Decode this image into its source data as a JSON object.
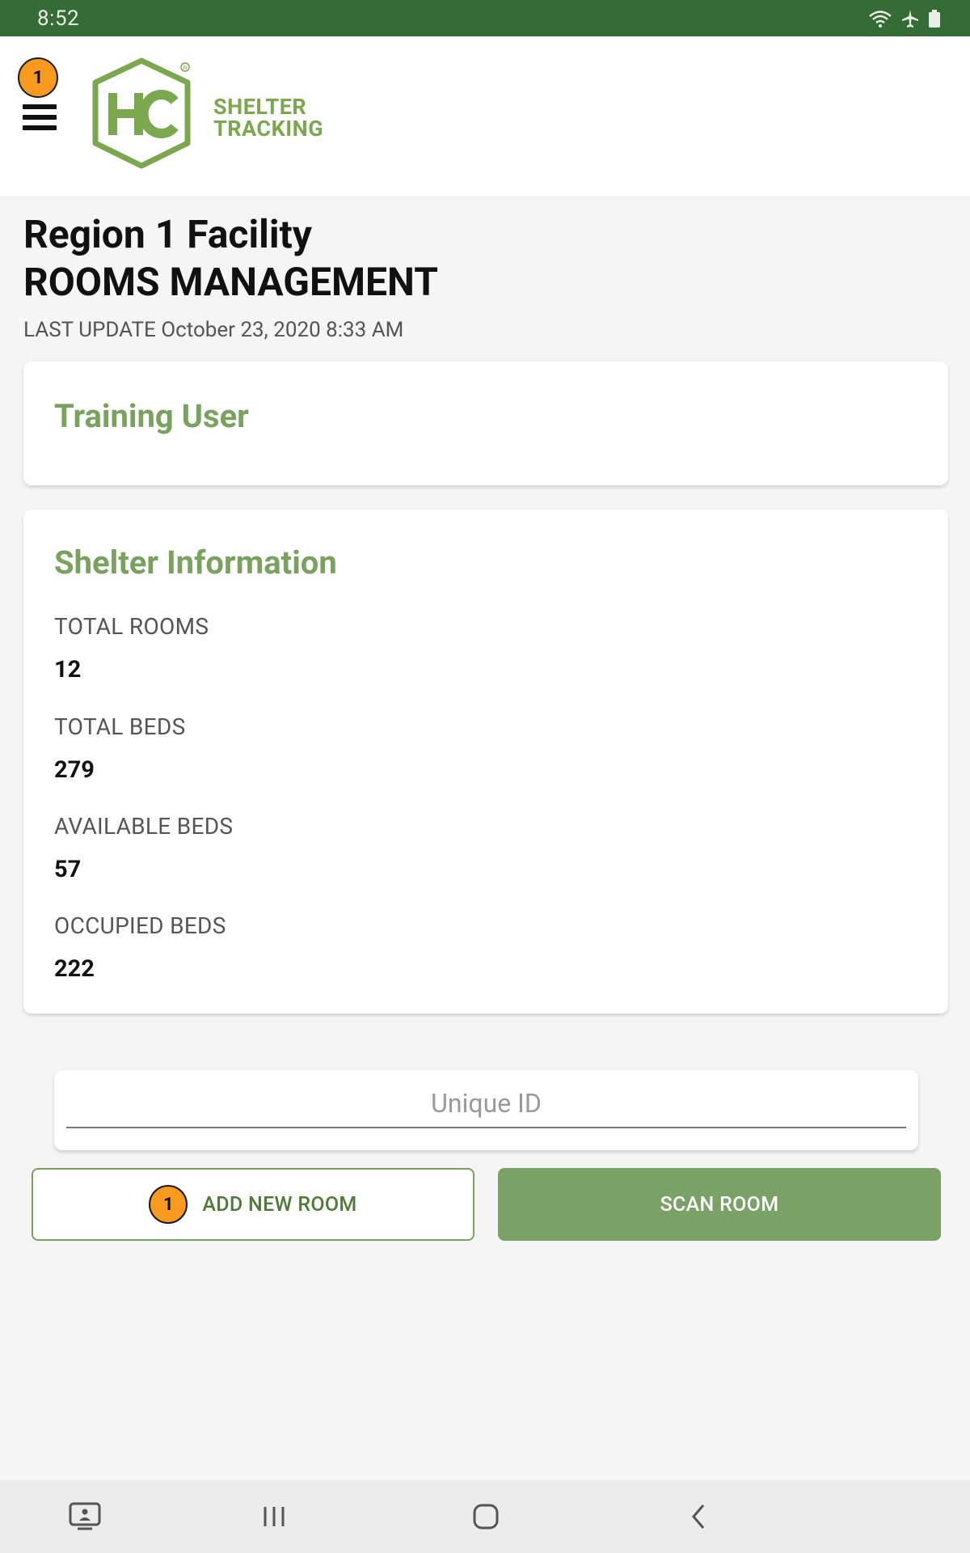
{
  "status_bar": {
    "time": "8:52",
    "icons": [
      "wifi-icon",
      "airplane-icon",
      "battery-icon"
    ],
    "bg_color": "#356b34"
  },
  "header": {
    "notification_count": "1",
    "menu_icon": "hamburger-menu-icon",
    "logo": {
      "mark": "HC",
      "tagline_line1": "SHELTER",
      "tagline_line2": "TRACKING",
      "color": "#7ba84e"
    }
  },
  "page": {
    "title_line1": "Region 1 Facility",
    "title_line2": "ROOMS MANAGEMENT",
    "last_update": "LAST UPDATE October 23, 2020 8:33 AM"
  },
  "user_card": {
    "name": "Training User"
  },
  "shelter_card": {
    "heading": "Shelter Information",
    "stats": [
      {
        "label": "TOTAL ROOMS",
        "value": "12"
      },
      {
        "label": "TOTAL BEDS",
        "value": "279"
      },
      {
        "label": "AVAILABLE BEDS",
        "value": "57"
      },
      {
        "label": "OCCUPIED BEDS",
        "value": "222"
      }
    ]
  },
  "search": {
    "placeholder": "Unique ID",
    "value": ""
  },
  "actions": {
    "add_room_badge": "1",
    "add_room_label": "ADD NEW ROOM",
    "scan_room_label": "SCAN ROOM"
  },
  "nav_bar": {
    "items": [
      "screen-share-icon",
      "recent-apps-icon",
      "home-icon",
      "back-icon"
    ]
  },
  "colors": {
    "accent_green": "#7aa25f",
    "badge_orange": "#f79a1e",
    "background": "#f5f5f5"
  }
}
